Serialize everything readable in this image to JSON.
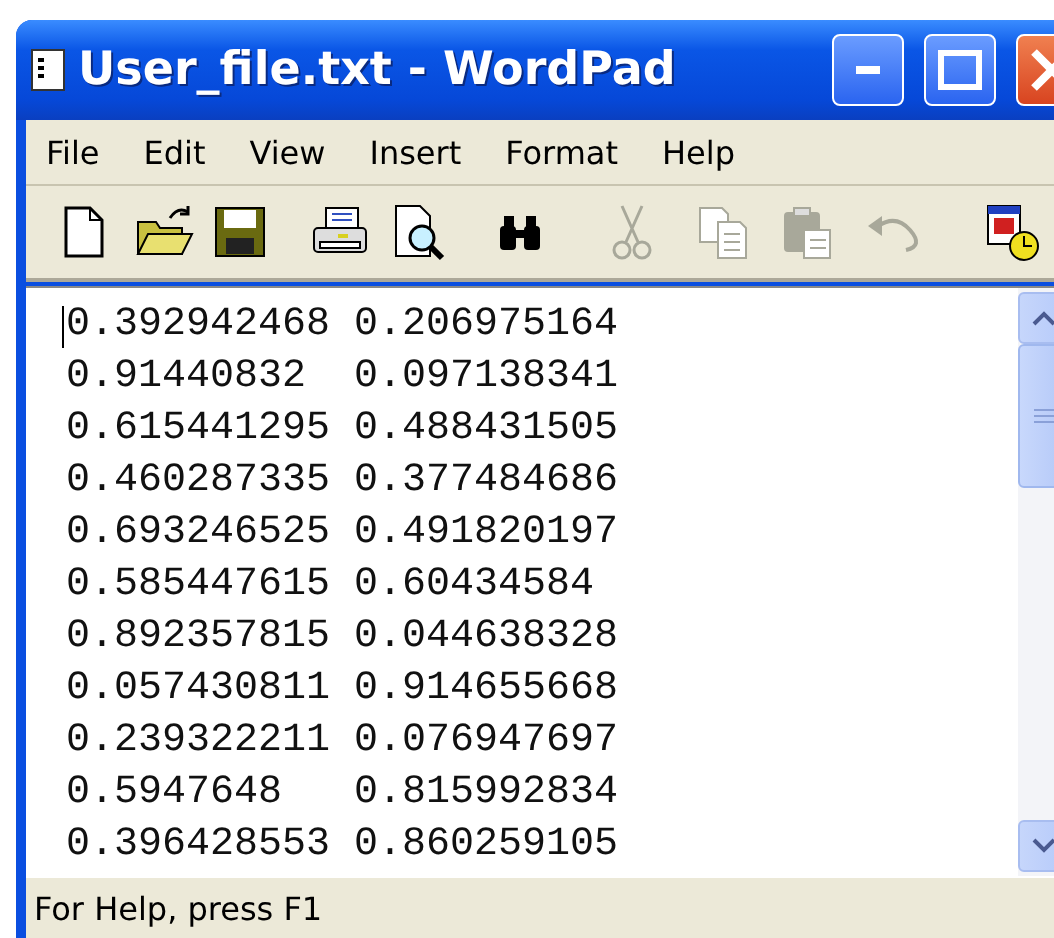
{
  "window": {
    "title": "User_file.txt - WordPad"
  },
  "menu": [
    "File",
    "Edit",
    "View",
    "Insert",
    "Format",
    "Help"
  ],
  "toolbar": [
    {
      "kind": "new",
      "disabled": false
    },
    {
      "kind": "open",
      "disabled": false
    },
    {
      "kind": "save",
      "disabled": false
    },
    {
      "kind": "print",
      "disabled": false
    },
    {
      "kind": "preview",
      "disabled": false
    },
    {
      "kind": "find",
      "disabled": false
    },
    {
      "kind": "cut",
      "disabled": true
    },
    {
      "kind": "copy",
      "disabled": true
    },
    {
      "kind": "paste",
      "disabled": true
    },
    {
      "kind": "undo",
      "disabled": true
    },
    {
      "kind": "datetime",
      "disabled": false
    }
  ],
  "document": {
    "lines": [
      "0.392942468 0.206975164",
      "0.91440832  0.097138341",
      "0.615441295 0.488431505",
      "0.460287335 0.377484686",
      "0.693246525 0.491820197",
      "0.585447615 0.60434584",
      "0.892357815 0.044638328",
      "0.057430811 0.914655668",
      "0.239322211 0.076947697",
      "0.5947648   0.815992834",
      "0.396428553 0.860259105"
    ]
  },
  "status_bar": "For Help, press F1"
}
